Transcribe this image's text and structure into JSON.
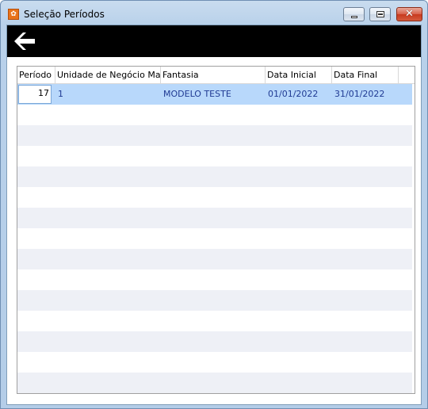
{
  "window": {
    "title": "Seleção Períodos",
    "app_icon": "app-logo-icon"
  },
  "titlebar_buttons": {
    "minimize": "minimize-icon",
    "maximize": "maximize-icon",
    "close": "close-icon",
    "close_glyph": "✕"
  },
  "toolbar": {
    "back_icon": "arrow-left-icon"
  },
  "grid": {
    "columns": [
      {
        "label": "Período"
      },
      {
        "label": "Unidade de Negócio Matriz"
      },
      {
        "label": "Fantasia"
      },
      {
        "label": "Data Inicial"
      },
      {
        "label": "Data Final"
      }
    ],
    "rows": [
      {
        "periodo": "17",
        "unidade": "1",
        "fantasia": "MODELO TESTE",
        "data_inicial": "01/01/2022",
        "data_final": "31/01/2022"
      }
    ],
    "selected_row_color": "#b8d8fb",
    "alt_row_color": "#eef0f6"
  }
}
